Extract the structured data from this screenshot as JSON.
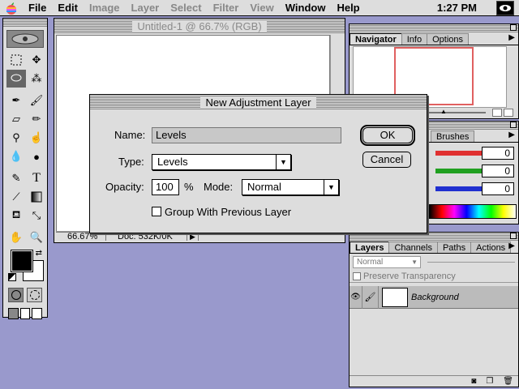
{
  "menubar": {
    "items": [
      {
        "label": "File",
        "enabled": true
      },
      {
        "label": "Edit",
        "enabled": true
      },
      {
        "label": "Image",
        "enabled": false
      },
      {
        "label": "Layer",
        "enabled": false
      },
      {
        "label": "Select",
        "enabled": false
      },
      {
        "label": "Filter",
        "enabled": false
      },
      {
        "label": "View",
        "enabled": false
      },
      {
        "label": "Window",
        "enabled": true
      },
      {
        "label": "Help",
        "enabled": true
      }
    ],
    "clock": "1:27 PM",
    "apple_icon": "apple-icon",
    "app_icon": "eye-app-icon"
  },
  "document": {
    "title": "Untitled-1 @ 66.7% (RGB)",
    "zoom": "66.67%",
    "doc_size": "Doc: 532K/0K"
  },
  "navigator": {
    "tabs": [
      "Navigator",
      "Info",
      "Options"
    ],
    "active_tab": "Navigator"
  },
  "color_palette": {
    "tabs": [
      "Brushes"
    ],
    "r_value": "0",
    "g_value": "0",
    "b_value": "0",
    "colors": {
      "r": "#e03030",
      "g": "#20a020",
      "b": "#2030d0"
    }
  },
  "layers_palette": {
    "tabs": [
      "Layers",
      "Channels",
      "Paths",
      "Actions"
    ],
    "active_tab": "Layers",
    "blend_mode": "Normal",
    "preserve_transparency": "Preserve Transparency",
    "layer_name": "Background"
  },
  "dialog": {
    "title": "New Adjustment Layer",
    "name_label": "Name:",
    "name_value": "Levels",
    "type_label": "Type:",
    "type_value": "Levels",
    "opacity_label": "Opacity:",
    "opacity_value": "100",
    "opacity_unit": "%",
    "mode_label": "Mode:",
    "mode_value": "Normal",
    "group_label": "Group With Previous Layer",
    "ok_label": "OK",
    "cancel_label": "Cancel"
  }
}
